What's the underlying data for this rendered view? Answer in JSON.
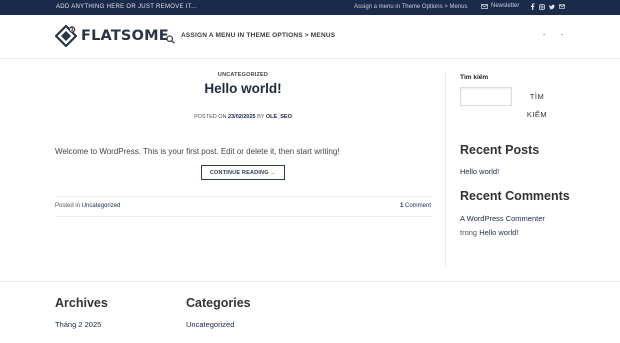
{
  "topbar": {
    "left_text": "ADD ANYTHING HERE OR JUST REMOVE IT...",
    "menu_hint": "Assign a menu in Theme Options > Menus",
    "newsletter_label": "Newsletter",
    "socials": [
      "facebook-icon",
      "instagram-icon",
      "twitter-icon",
      "email-icon"
    ],
    "bg_color": "#1a2a49"
  },
  "header": {
    "logo_text": "FLATSOME",
    "nav_hint": "ASSIGN A MENU IN THEME OPTIONS > MENUS",
    "right_items": [
      "-",
      "-"
    ]
  },
  "post": {
    "category": "UNCATEGORIZED",
    "title": "Hello world!",
    "meta_prefix": "POSTED ON",
    "date": "23/02/2025",
    "meta_by": "BY",
    "author": "OLE_SEO",
    "excerpt": "Welcome to WordPress. This is your first post. Edit or delete it, then start writing!",
    "read_more": "CONTINUE READING →",
    "posted_in_label": "Posted in",
    "posted_in_category": "Uncategorized",
    "comments_count": "1",
    "comments_label": "Comment"
  },
  "sidebar": {
    "search_label": "Tìm kiếm",
    "search_button_line1": "TÌM",
    "search_button_line2": "KIẾM",
    "recent_posts_heading": "Recent Posts",
    "recent_posts": [
      "Hello world!"
    ],
    "recent_comments_heading": "Recent Comments",
    "comment_author": "A WordPress Commenter",
    "comment_connector": "trong",
    "comment_post": "Hello world!"
  },
  "footer": {
    "archives_heading": "Archives",
    "archives_item": "Tháng 2 2025",
    "categories_heading": "Categories",
    "categories_item": "Uncategorized"
  },
  "colors": {
    "accent": "#1a2a49",
    "text": "#333333",
    "border": "#ececec"
  }
}
